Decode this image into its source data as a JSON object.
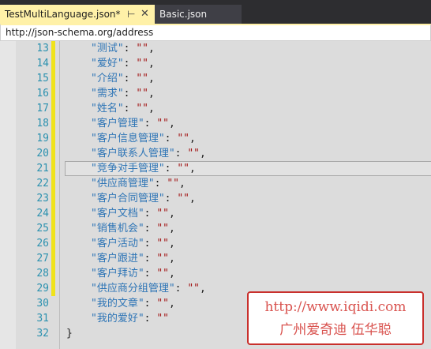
{
  "tabs": [
    {
      "label": "TestMultiLanguage.json*",
      "active": true
    },
    {
      "label": "Basic.json",
      "active": false
    }
  ],
  "tab_icons": {
    "pin": "pin-icon",
    "close": "close-icon"
  },
  "navigation": {
    "schema_url": "http://json-schema.org/address"
  },
  "editor": {
    "lines": [
      {
        "num": "13",
        "key": "\"测试\"",
        "value": "\"\"",
        "trail": ",",
        "changed": true
      },
      {
        "num": "14",
        "key": "\"爱好\"",
        "value": "\"\"",
        "trail": ",",
        "changed": true
      },
      {
        "num": "15",
        "key": "\"介绍\"",
        "value": "\"\"",
        "trail": ",",
        "changed": true
      },
      {
        "num": "16",
        "key": "\"需求\"",
        "value": "\"\"",
        "trail": ",",
        "changed": true
      },
      {
        "num": "17",
        "key": "\"姓名\"",
        "value": "\"\"",
        "trail": ",",
        "changed": true
      },
      {
        "num": "18",
        "key": "\"客户管理\"",
        "value": "\"\"",
        "trail": ",",
        "changed": true
      },
      {
        "num": "19",
        "key": "\"客户信息管理\"",
        "value": "\"\"",
        "trail": ",",
        "changed": true
      },
      {
        "num": "20",
        "key": "\"客户联系人管理\"",
        "value": "\"\"",
        "trail": ",",
        "changed": true
      },
      {
        "num": "21",
        "key": "\"竞争对手管理\"",
        "value": "\"\"",
        "trail": ",",
        "changed": true,
        "current": true
      },
      {
        "num": "22",
        "key": "\"供应商管理\"",
        "value": "\"\"",
        "trail": ",",
        "changed": true
      },
      {
        "num": "23",
        "key": "\"客户合同管理\"",
        "value": "\"\"",
        "trail": ",",
        "changed": true
      },
      {
        "num": "24",
        "key": "\"客户文档\"",
        "value": "\"\"",
        "trail": ",",
        "changed": true
      },
      {
        "num": "25",
        "key": "\"销售机会\"",
        "value": "\"\"",
        "trail": ",",
        "changed": true
      },
      {
        "num": "26",
        "key": "\"客户活动\"",
        "value": "\"\"",
        "trail": ",",
        "changed": true
      },
      {
        "num": "27",
        "key": "\"客户跟进\"",
        "value": "\"\"",
        "trail": ",",
        "changed": true
      },
      {
        "num": "28",
        "key": "\"客户拜访\"",
        "value": "\"\"",
        "trail": ",",
        "changed": true
      },
      {
        "num": "29",
        "key": "\"供应商分组管理\"",
        "value": "\"\"",
        "trail": ",",
        "changed": true
      },
      {
        "num": "30",
        "key": "\"我的文章\"",
        "value": "\"\"",
        "trail": ",",
        "changed": false
      },
      {
        "num": "31",
        "key": "\"我的爱好\"",
        "value": "\"\"",
        "trail": "",
        "changed": false
      }
    ],
    "closing": {
      "num": "32",
      "text": "}"
    }
  },
  "watermark": {
    "url": "http://www.iqidi.com",
    "name": "广州爱奇迪  伍华聪"
  },
  "colors": {
    "key": "#2e75b6",
    "string": "#a31515",
    "line_number": "#2b91af",
    "change_marker": "#f0e31b",
    "active_tab": "#fff1a8",
    "watermark": "#c9302c"
  }
}
